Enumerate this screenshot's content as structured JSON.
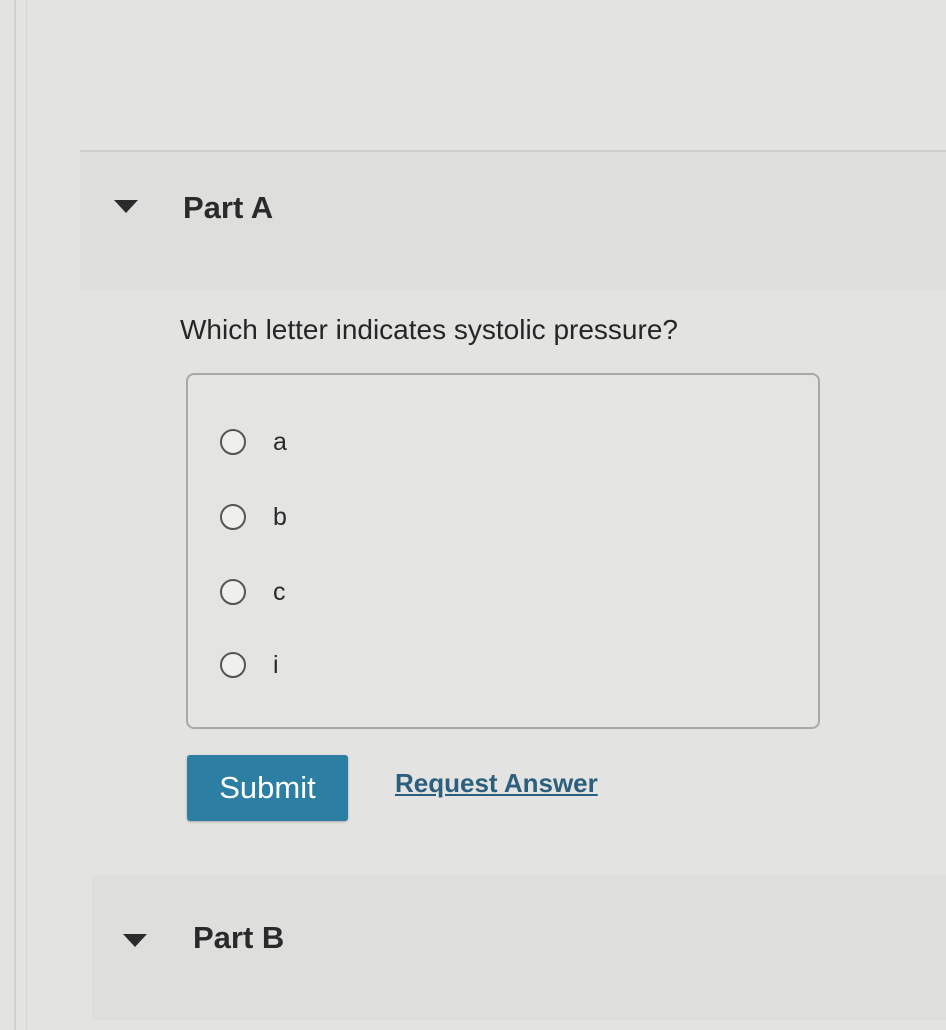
{
  "part_a": {
    "title": "Part A",
    "question": "Which letter indicates systolic pressure?",
    "options": [
      {
        "label": "a",
        "selected": false
      },
      {
        "label": "b",
        "selected": false
      },
      {
        "label": "c",
        "selected": false
      },
      {
        "label": "i",
        "selected": false
      }
    ],
    "submit_label": "Submit",
    "request_answer_label": "Request Answer"
  },
  "part_b": {
    "title": "Part B"
  },
  "colors": {
    "submit_button": "#2c7fa3",
    "link": "#2b5f7d",
    "background": "#e3e3e1"
  },
  "icons": {
    "collapse": "caret-down-icon",
    "option": "radio-icon"
  }
}
